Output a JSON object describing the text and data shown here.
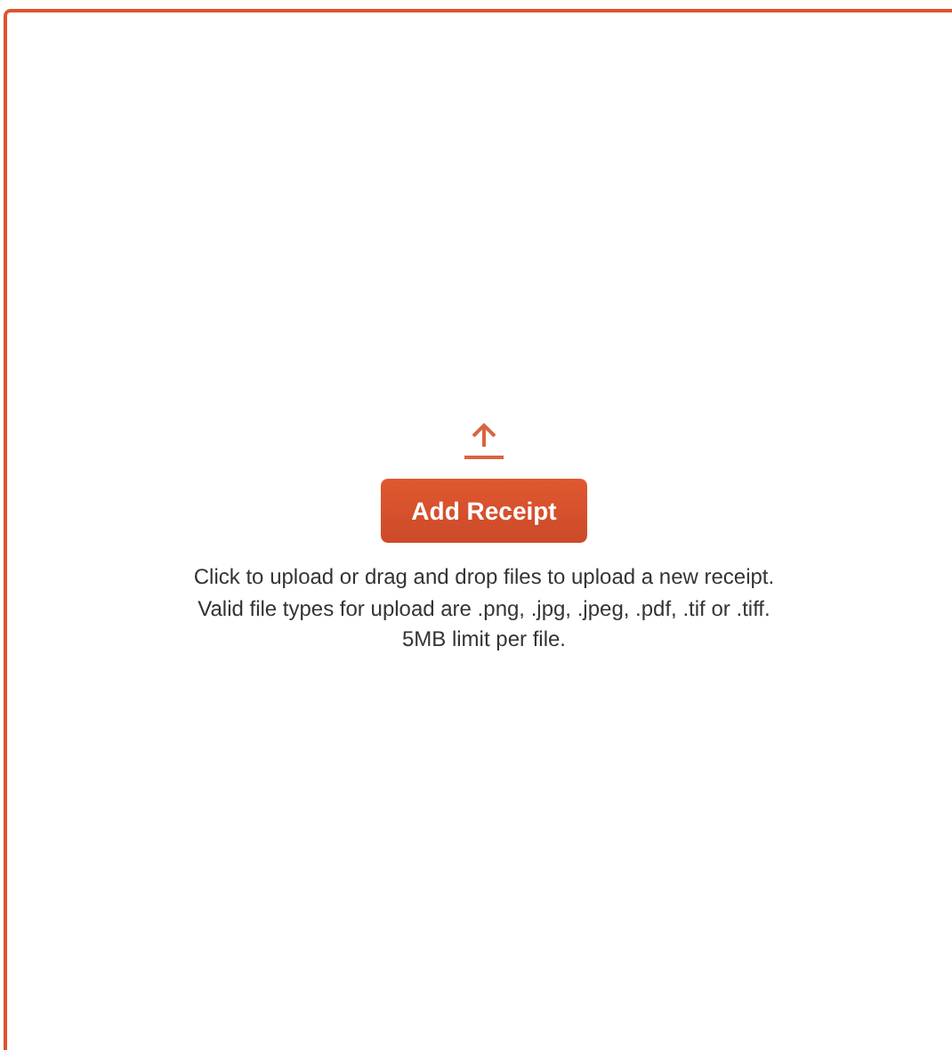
{
  "dropzone": {
    "button": "Add Receipt",
    "instructions": [
      "Click to upload or drag and drop files to upload a new receipt.",
      "Valid file types for upload are .png, .jpg, .jpeg, .pdf, .tif or .tiff.",
      "5MB limit per file."
    ]
  }
}
